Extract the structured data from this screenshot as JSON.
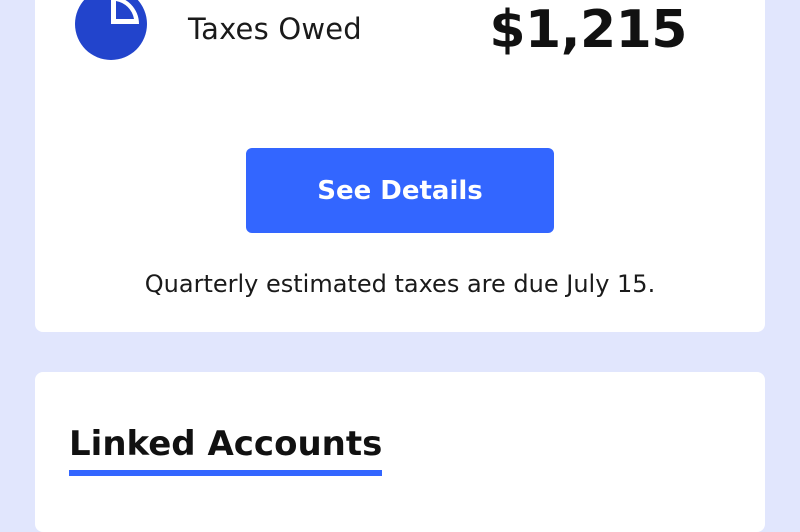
{
  "taxes": {
    "label": "Taxes Owed",
    "amount": "$1,215",
    "icon": "pie-chart-icon",
    "button_label": "See Details",
    "note": "Quarterly estimated taxes are due July 15."
  },
  "linked_accounts": {
    "title": "Linked Accounts"
  },
  "colors": {
    "background": "#e1e6fd",
    "card": "#ffffff",
    "accent": "#3366ff",
    "icon": "#2244cc"
  }
}
